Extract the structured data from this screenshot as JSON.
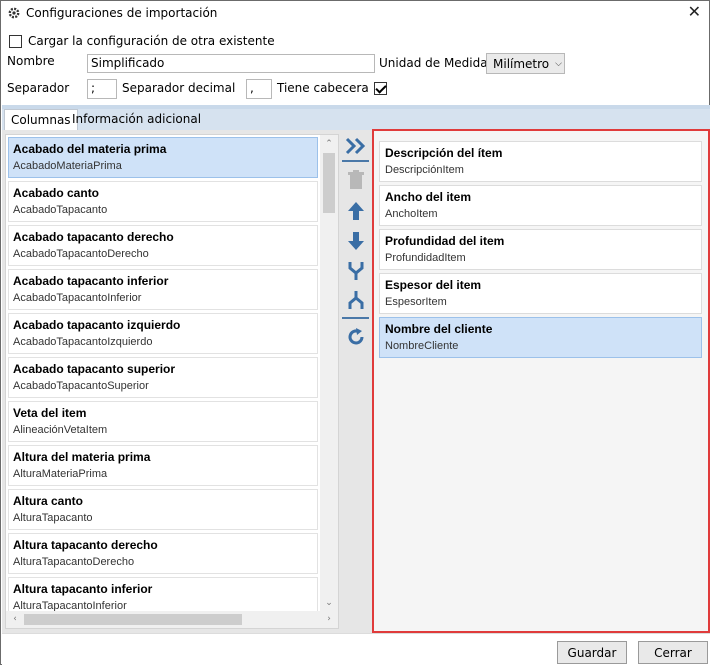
{
  "window": {
    "title": "Configuraciones de importación"
  },
  "options": {
    "load_existing_label": "Cargar la configuración de otra existente",
    "load_existing_checked": false,
    "name_label": "Nombre",
    "name_value": "Simplificado",
    "unit_label": "Unidad de Medida :",
    "unit_value": "Milímetro",
    "separator_label": "Separador",
    "separator_value": ";",
    "decimal_separator_label": "Separador decimal",
    "decimal_separator_value": ",",
    "has_header_label": "Tiene cabecera",
    "has_header_checked": true
  },
  "tabs": [
    {
      "label": "Columnas",
      "active": true
    },
    {
      "label": "Información adicional",
      "active": false
    }
  ],
  "available_columns": [
    {
      "title": "Acabado del materia prima",
      "key": "AcabadoMateriaPrima",
      "selected": true
    },
    {
      "title": "Acabado canto",
      "key": "AcabadoTapacanto"
    },
    {
      "title": "Acabado tapacanto derecho",
      "key": "AcabadoTapacantoDerecho"
    },
    {
      "title": "Acabado tapacanto inferior",
      "key": "AcabadoTapacantoInferior"
    },
    {
      "title": "Acabado tapacanto izquierdo",
      "key": "AcabadoTapacantoIzquierdo"
    },
    {
      "title": "Acabado tapacanto superior",
      "key": "AcabadoTapacantoSuperior"
    },
    {
      "title": "Veta del item",
      "key": "AlineaciónVetaItem"
    },
    {
      "title": "Altura del materia prima",
      "key": "AlturaMateriaPrima"
    },
    {
      "title": "Altura canto",
      "key": "AlturaTapacanto"
    },
    {
      "title": "Altura tapacanto derecho",
      "key": "AlturaTapacantoDerecho"
    },
    {
      "title": "Altura tapacanto inferior",
      "key": "AlturaTapacantoInferior"
    }
  ],
  "selected_columns": [
    {
      "title": "Descripción del ítem",
      "key": "DescripciónItem"
    },
    {
      "title": "Ancho del item",
      "key": "AnchoItem"
    },
    {
      "title": "Profundidad del item",
      "key": "ProfundidadItem"
    },
    {
      "title": "Espesor del item",
      "key": "EspesorItem"
    },
    {
      "title": "Nombre del cliente",
      "key": "NombreCliente",
      "selected": true
    }
  ],
  "toolbar": {
    "icons": [
      "add-all-icon",
      "delete-icon",
      "move-up-icon",
      "move-down-icon",
      "merge-icon",
      "split-icon",
      "refresh-icon"
    ]
  },
  "footer": {
    "save_label": "Guardar",
    "close_label": "Cerrar"
  },
  "colors": {
    "accent": "#3a6ea5",
    "selection": "#cfe2f8",
    "highlight_border": "#e03b3b"
  }
}
